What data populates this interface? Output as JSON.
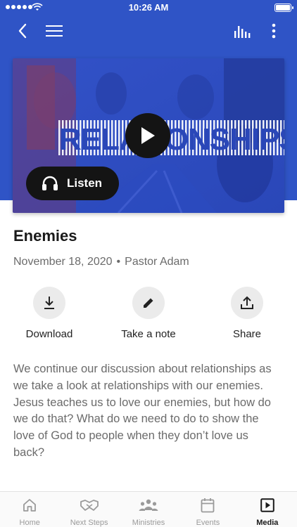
{
  "status_bar": {
    "time": "10:26 AM"
  },
  "media": {
    "banner_text": "RELATIONSHIPS",
    "listen_label": "Listen",
    "play_icon": "play-icon",
    "headphones_icon": "headphones-icon"
  },
  "sermon": {
    "title": "Enemies",
    "date": "November 18, 2020",
    "separator": "•",
    "speaker": "Pastor Adam",
    "description": "We continue our discussion about relationships as we take a look at relationships with our enemies. Jesus teaches us to love our enemies, but how do we do that? What do we need to do to show the love of God to people when they don’t love us back?"
  },
  "actions": [
    {
      "label": "Download",
      "icon": "download-icon"
    },
    {
      "label": "Take a note",
      "icon": "pencil-icon"
    },
    {
      "label": "Share",
      "icon": "share-icon"
    }
  ],
  "tabs": [
    {
      "label": "Home",
      "icon": "home-icon",
      "active": false
    },
    {
      "label": "Next Steps",
      "icon": "handshake-icon",
      "active": false
    },
    {
      "label": "Ministries",
      "icon": "people-icon",
      "active": false
    },
    {
      "label": "Events",
      "icon": "calendar-icon",
      "active": false
    },
    {
      "label": "Media",
      "icon": "media-play-icon",
      "active": true
    }
  ],
  "colors": {
    "header_blue": "#2f54c6",
    "inactive_tab": "#9a9a9a",
    "active_tab": "#1a1a1a"
  }
}
